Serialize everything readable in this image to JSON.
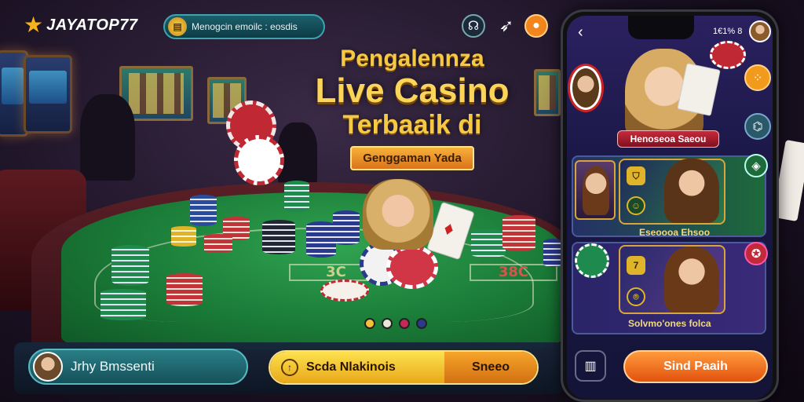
{
  "header": {
    "logo_text": "JAYATOP77",
    "notice_text": "Menogcin emoilc : eosdis",
    "notice_icon": "coin-icon",
    "icons": [
      "headset-icon",
      "rocket-icon",
      "coin-ring-icon"
    ]
  },
  "headline": {
    "line1": "Pengalennza",
    "line2": "Live Casino",
    "line3": "Terbaaik di",
    "ribbon": "Genggaman Yada"
  },
  "table": {
    "bet_left": "3C",
    "bet_right": "38C"
  },
  "bottom": {
    "player_name": "Jrhy Bmssenti",
    "action_label": "Scda Nlakinois",
    "action_right": "Sneeo"
  },
  "phone": {
    "status_text": "1€1% 8",
    "hero_name": "Henoseoa Saeou",
    "panel1_label": "Eseoooa Ehsoo",
    "panel2_label": "Solvmo'ones folca",
    "send_button": "Sind Paaih",
    "grid_icon": "grid-icon"
  },
  "colors": {
    "gold": "#f6c945",
    "felt": "#1a7a37",
    "accent_orange": "#e2520e",
    "teal": "#1b5f6c"
  }
}
